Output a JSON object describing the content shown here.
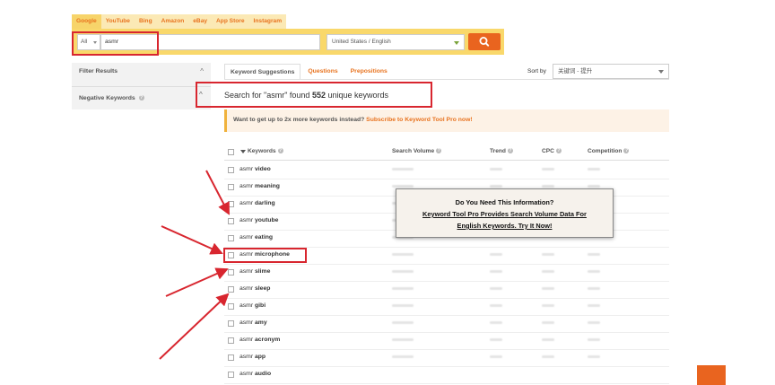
{
  "source_tabs": [
    "Google",
    "YouTube",
    "Bing",
    "Amazon",
    "eBay",
    "App Store",
    "Instagram"
  ],
  "search": {
    "scope": "All",
    "query": "asmr",
    "location": "United States / English"
  },
  "sidebar": {
    "filter_label": "Filter Results",
    "negative_label": "Negative Keywords"
  },
  "result_tabs": [
    "Keyword Suggestions",
    "Questions",
    "Prepositions"
  ],
  "sort": {
    "label": "Sort by",
    "value": "关键词 - 提升"
  },
  "found": {
    "prefix": "Search for \"asmr\" found",
    "count": "552",
    "suffix": "unique keywords"
  },
  "promo": {
    "text": "Want to get up to 2x more keywords instead?",
    "link": "Subscribe to Keyword Tool Pro now!"
  },
  "table": {
    "headers": {
      "keywords": "Keywords",
      "volume": "Search Volume",
      "trend": "Trend",
      "cpc": "CPC",
      "competition": "Competition"
    },
    "rows": [
      {
        "prefix": "asmr",
        "term": "video"
      },
      {
        "prefix": "asmr",
        "term": "meaning"
      },
      {
        "prefix": "asmr",
        "term": "darling"
      },
      {
        "prefix": "asmr",
        "term": "youtube"
      },
      {
        "prefix": "asmr",
        "term": "eating"
      },
      {
        "prefix": "asmr",
        "term": "microphone"
      },
      {
        "prefix": "asmr",
        "term": "slime"
      },
      {
        "prefix": "asmr",
        "term": "sleep"
      },
      {
        "prefix": "asmr",
        "term": "gibi"
      },
      {
        "prefix": "asmr",
        "term": "amy"
      },
      {
        "prefix": "asmr",
        "term": "acronym"
      },
      {
        "prefix": "asmr",
        "term": "app"
      },
      {
        "prefix": "asmr",
        "term": "audio"
      }
    ]
  },
  "popup": {
    "line1": "Do You Need This Information?",
    "line2": "Keyword Tool Pro Provides Search Volume Data For",
    "line3": "English Keywords. Try It Now!"
  },
  "colors": {
    "accent": "#e8731f",
    "band": "#f9d86b",
    "annotation": "#d8262f"
  },
  "icons": {
    "search_button": "search-icon",
    "info": "info-icon",
    "collapse": "chevron-up-icon",
    "dropdown": "caret-down-icon"
  }
}
